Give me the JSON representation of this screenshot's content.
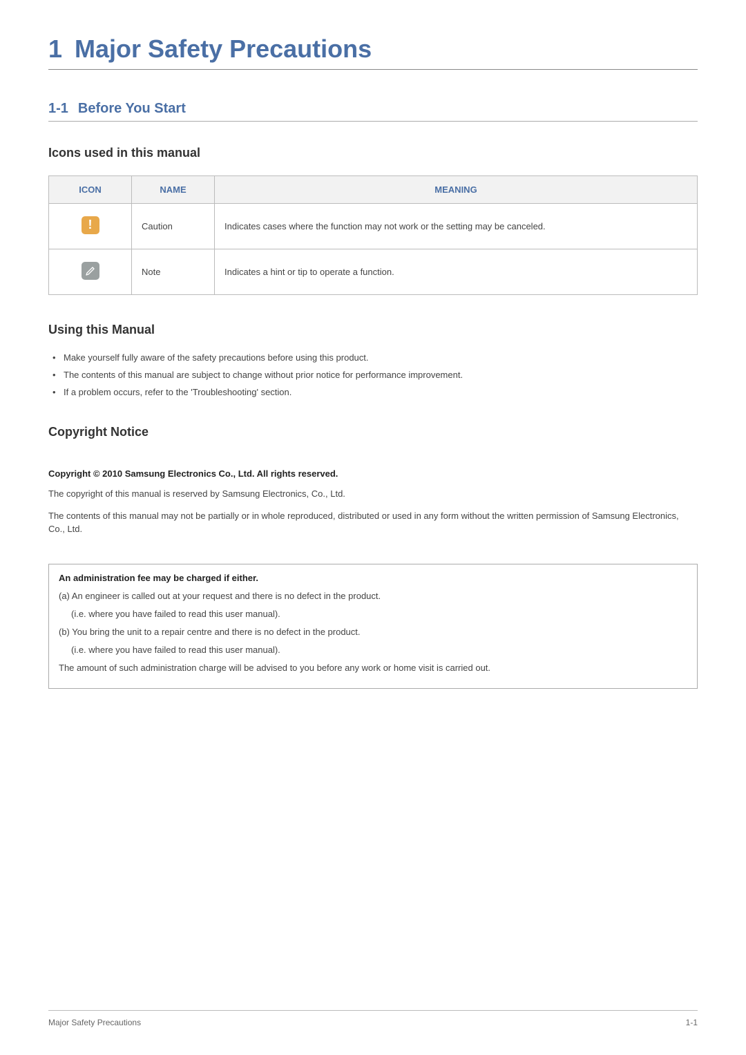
{
  "chapter": {
    "number": "1",
    "title": "Major Safety Precautions"
  },
  "section": {
    "number": "1-1",
    "title": "Before You Start"
  },
  "icons_heading": "Icons used in this manual",
  "icons_table": {
    "headers": {
      "icon": "ICON",
      "name": "NAME",
      "meaning": "MEANING"
    },
    "rows": [
      {
        "name": "Caution",
        "meaning": "Indicates cases where the function may not work or the setting may be canceled."
      },
      {
        "name": "Note",
        "meaning": "Indicates a hint or tip to operate a function."
      }
    ]
  },
  "using_heading": "Using this Manual",
  "using_bullets": [
    "Make yourself fully aware of the safety precautions before using this product.",
    "The contents of this manual are subject to change without prior notice for performance improvement.",
    "If a problem occurs, refer to the 'Troubleshooting' section."
  ],
  "copyright_heading": "Copyright Notice",
  "copyright_bold": "Copyright © 2010 Samsung Electronics Co., Ltd. All rights reserved.",
  "copyright_p1": "The copyright of this manual is reserved by Samsung Electronics, Co., Ltd.",
  "copyright_p2": "The contents of this manual may not be partially or in whole reproduced, distributed or used in any form without the written permission of Samsung Electronics, Co., Ltd.",
  "notice": {
    "heading": "An administration fee may be charged if either.",
    "a": "(a) An engineer is called out at your request and there is no defect in the product.",
    "a_sub": "(i.e. where you have failed to read this user manual).",
    "b": "(b) You bring the unit to a repair centre and there is no defect in the product.",
    "b_sub": "(i.e. where you have failed to read this user manual).",
    "tail": "The amount of such administration charge will be advised to you before any work or home visit is carried out."
  },
  "footer": {
    "left": "Major Safety Precautions",
    "right": "1-1"
  }
}
